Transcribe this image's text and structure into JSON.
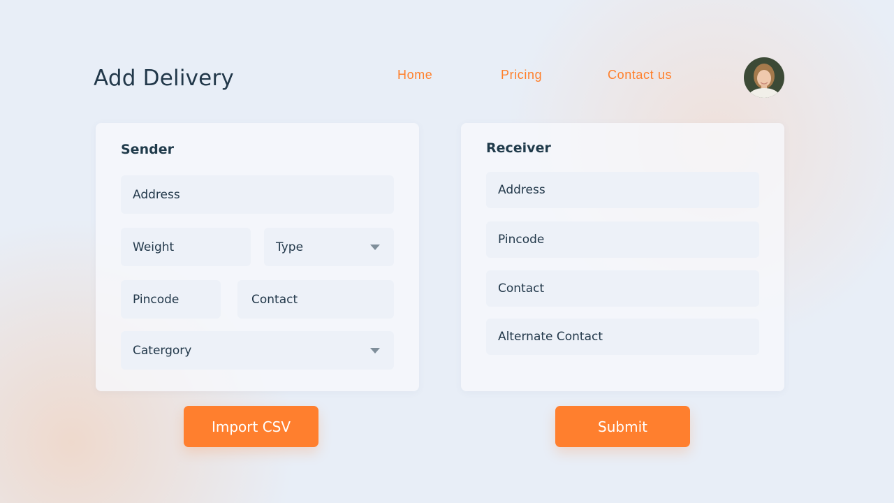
{
  "page": {
    "title": "Add Delivery"
  },
  "nav": {
    "items": [
      {
        "label": "Home"
      },
      {
        "label": "Pricing"
      },
      {
        "label": "Contact us"
      }
    ],
    "link_color": "#ff7f2a"
  },
  "user": {
    "avatar_icon": "user-avatar-photo"
  },
  "sender": {
    "title": "Sender",
    "address": "Address",
    "weight": "Weight",
    "type": {
      "label": "Type",
      "icon": "chevron-down-icon"
    },
    "pincode": "Pincode",
    "contact": "Contact",
    "category": {
      "label": "Catergory",
      "icon": "chevron-down-icon"
    }
  },
  "receiver": {
    "title": "Receiver",
    "address": "Address",
    "pincode": "Pincode",
    "contact": "Contact",
    "alternate_contact": "Alternate Contact"
  },
  "actions": {
    "import_label": "Import CSV",
    "submit_label": "Submit",
    "accent_color": "#ff7f2e"
  }
}
